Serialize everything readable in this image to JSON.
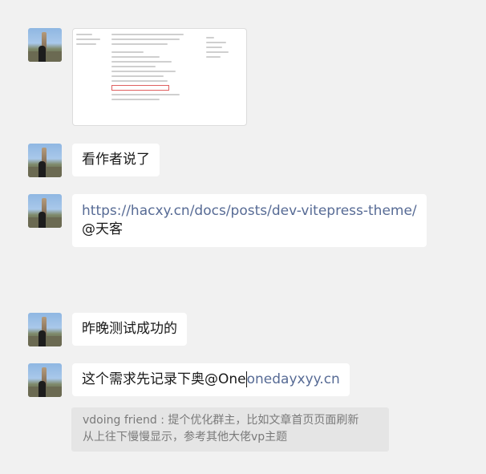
{
  "messages": [
    {
      "type": "image"
    },
    {
      "type": "text",
      "text": "看作者说了"
    },
    {
      "type": "link",
      "url": "https://hacxy.cn/docs/posts/dev-vitepress-theme/",
      "mention": "@天客"
    },
    {
      "type": "text",
      "text": "昨晚测试成功的"
    },
    {
      "type": "text_link",
      "text": "这个需求先记录下奥@One",
      "link": "onedayxyy.cn"
    }
  ],
  "quote": {
    "line1": "vdoing friend : 提个优化群主，比如文章首页页面刷新",
    "line2": "从上往下慢慢显示，参考其他大佬vp主题"
  },
  "icons": [
    "avatar-photo"
  ]
}
